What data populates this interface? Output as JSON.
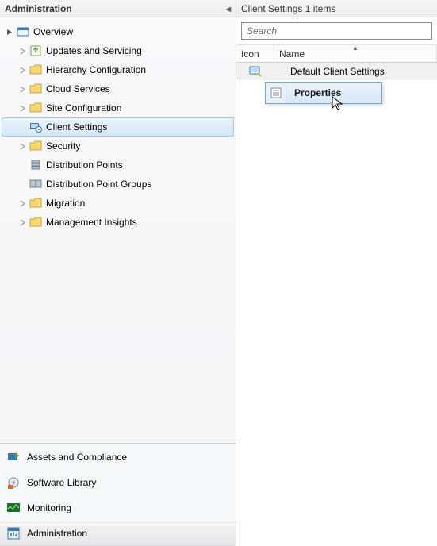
{
  "leftPane": {
    "title": "Administration",
    "tree": {
      "overview": "Overview",
      "updates": "Updates and Servicing",
      "hierarchy": "Hierarchy Configuration",
      "cloud": "Cloud Services",
      "site": "Site Configuration",
      "clientSettings": "Client Settings",
      "security": "Security",
      "distPoints": "Distribution Points",
      "distGroups": "Distribution Point Groups",
      "migration": "Migration",
      "mgmtInsights": "Management Insights"
    }
  },
  "workspaces": {
    "assets": "Assets and Compliance",
    "library": "Software Library",
    "monitoring": "Monitoring",
    "administration": "Administration"
  },
  "rightPane": {
    "title": "Client Settings 1 items",
    "searchPlaceholder": "Search",
    "columns": {
      "icon": "Icon",
      "name": "Name"
    },
    "row": {
      "name": "Default Client Settings"
    },
    "contextMenu": {
      "properties": "Properties"
    }
  }
}
